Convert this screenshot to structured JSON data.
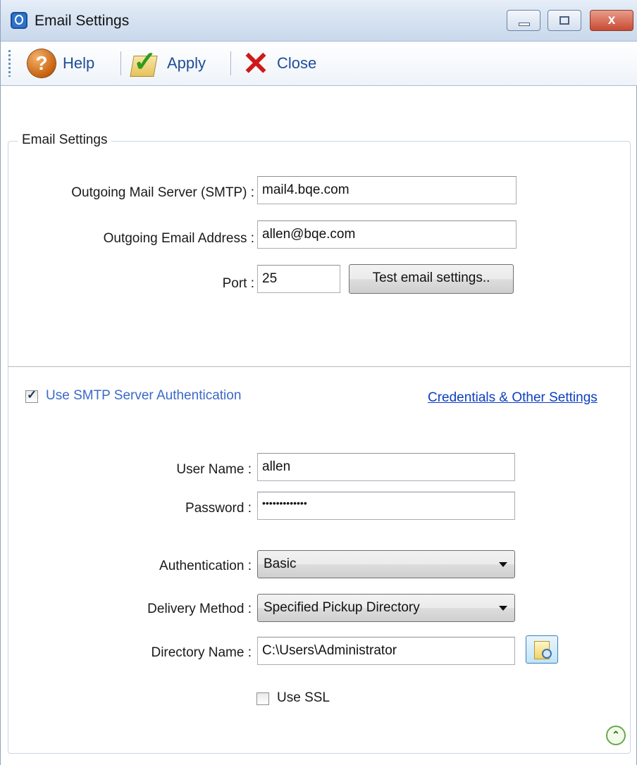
{
  "window": {
    "title": "Email Settings",
    "icons": {
      "app": "app-logo-icon",
      "minimize": "minimize-icon",
      "maximize": "maximize-icon",
      "close": "close-icon"
    },
    "close_glyph": "x"
  },
  "toolbar": {
    "help_label": "Help",
    "apply_label": "Apply",
    "close_label": "Close"
  },
  "group": {
    "legend": "Email Settings"
  },
  "server": {
    "smtp_label": "Outgoing Mail Server (SMTP) :",
    "smtp_value": "mail4.bqe.com",
    "email_label": "Outgoing Email Address :",
    "email_value": "allen@bqe.com",
    "port_label": "Port :",
    "port_value": "25",
    "test_button": "Test email settings.."
  },
  "auth": {
    "use_smtp_auth_label": "Use SMTP Server Authentication",
    "use_smtp_auth_checked": true,
    "credentials_link": "Credentials & Other Settings",
    "username_label": "User Name :",
    "username_value": "allen",
    "password_label": "Password :",
    "password_value": "•••••••••••••",
    "authentication_label": "Authentication :",
    "authentication_value": "Basic",
    "delivery_label": "Delivery Method :",
    "delivery_value": "Specified Pickup Directory",
    "directory_label": "Directory Name :",
    "directory_value": "C:\\Users\\Administrator",
    "use_ssl_label": "Use SSL",
    "use_ssl_checked": false
  },
  "colors": {
    "link": "#0b3fc1",
    "toolbar_text": "#1f4d99",
    "close_red": "#d01818",
    "apply_green": "#2e9c1c"
  }
}
